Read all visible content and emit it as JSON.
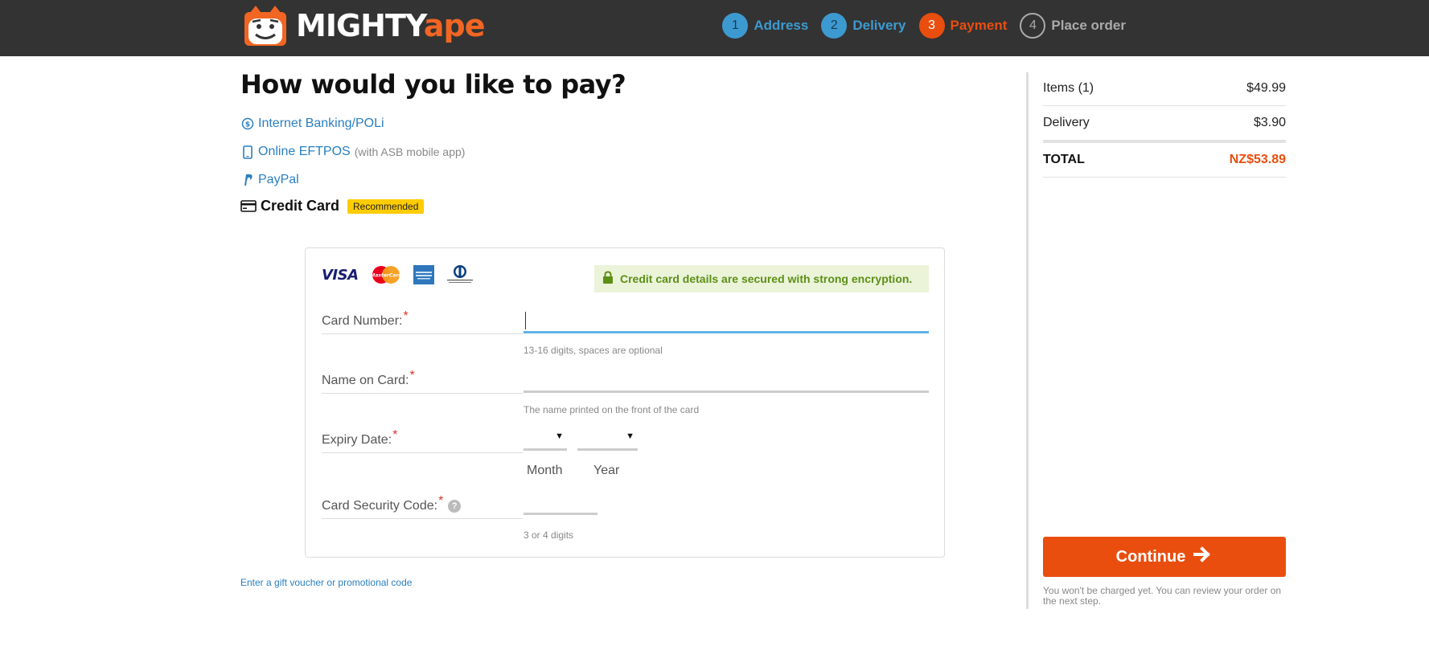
{
  "header": {
    "brand_part1": "MIGHTY",
    "brand_part2": "ape",
    "steps": [
      {
        "num": "1",
        "label": "Address",
        "state": "done"
      },
      {
        "num": "2",
        "label": "Delivery",
        "state": "done"
      },
      {
        "num": "3",
        "label": "Payment",
        "state": "active"
      },
      {
        "num": "4",
        "label": "Place order",
        "state": "pending"
      }
    ]
  },
  "payment": {
    "title": "How would you like to pay?",
    "options": {
      "internet_banking": {
        "label": "Internet Banking/POLi",
        "icon": "dollar-circle-icon"
      },
      "online_eftpos": {
        "label": "Online EFTPOS",
        "note": "(with ASB mobile app)",
        "icon": "mobile-phone-icon"
      },
      "paypal": {
        "label": "PayPal",
        "icon": "paypal-icon"
      },
      "credit_card": {
        "label": "Credit Card",
        "badge": "Recommended",
        "icon": "credit-card-icon"
      }
    },
    "card_logos": [
      "VISA",
      "MasterCard",
      "American Express",
      "Diners Club International"
    ],
    "secure_note": "Credit card details are secured with strong encryption.",
    "fields": {
      "card_number": {
        "label": "Card Number:",
        "required": "*",
        "value": "",
        "hint": "13-16 digits, spaces are optional"
      },
      "name_on_card": {
        "label": "Name on Card:",
        "required": "*",
        "value": "",
        "hint": "The name printed on the front of the card"
      },
      "expiry": {
        "label": "Expiry Date:",
        "required": "*",
        "month_caption": "Month",
        "year_caption": "Year"
      },
      "security_code": {
        "label": "Card Security Code:",
        "required": "*",
        "help": "?",
        "hint": "3 or 4 digits"
      }
    },
    "gift_link": "Enter a gift voucher or promotional code"
  },
  "summary": {
    "items_label": "Items (1)",
    "items_value": "$49.99",
    "delivery_label": "Delivery",
    "delivery_value": "$3.90",
    "total_label": "TOTAL",
    "total_value": "NZ$53.89",
    "continue_label": "Continue",
    "note": "You won't be charged yet. You can review your order on the next step."
  },
  "colors": {
    "header_bg": "#333333",
    "accent_orange": "#e94e0f",
    "link_blue": "#2a7fc1",
    "step_done_blue": "#3d9ad1",
    "badge_yellow": "#ffcc00",
    "secure_green": "#5d8f17",
    "secure_bg": "#ebf3d9"
  }
}
